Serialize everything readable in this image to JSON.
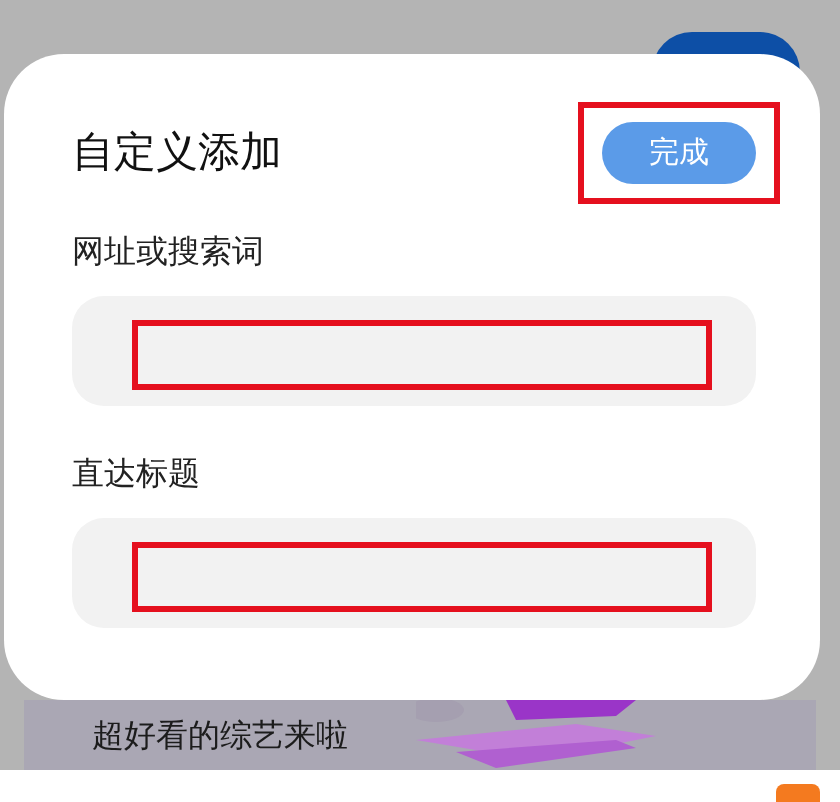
{
  "background": {
    "banner_text": "超好看的综艺来啦"
  },
  "dialog": {
    "title": "自定义添加",
    "done_button": {
      "label": "完成",
      "highlighted": true
    },
    "fields": [
      {
        "label": "网址或搜索词",
        "highlighted": true
      },
      {
        "label": "直达标题",
        "highlighted": true
      }
    ]
  }
}
